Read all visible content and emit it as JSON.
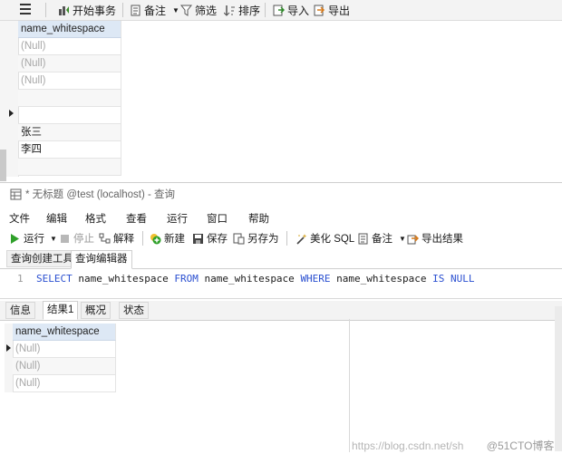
{
  "top_toolbar": {
    "begin_transaction": "开始事务",
    "notes": "备注",
    "filter": "筛选",
    "sort": "排序",
    "import": "导入",
    "export": "导出"
  },
  "top_grid": {
    "column": "name_whitespace",
    "rows": [
      "(Null)",
      "(Null)",
      "(Null)",
      "",
      "",
      "张三",
      "李四",
      ""
    ]
  },
  "query_window": {
    "title": "* 无标题 @test (localhost) - 查询",
    "menu": [
      "文件",
      "编辑",
      "格式",
      "查看",
      "运行",
      "窗口",
      "帮助"
    ],
    "toolbar": {
      "run": "运行",
      "stop": "停止",
      "explain": "解释",
      "new": "新建",
      "save": "保存",
      "save_as": "另存为",
      "beautify_sql": "美化 SQL",
      "notes": "备注",
      "export_result": "导出结果"
    },
    "tabs": {
      "builder": "查询创建工具",
      "editor": "查询编辑器"
    },
    "editor": {
      "line_number": "1",
      "sql": {
        "select": "SELECT",
        "col": " name_whitespace ",
        "from": "FROM",
        "table": " name_whitespace ",
        "where": "WHERE",
        "col2": " name_whitespace ",
        "is": "IS",
        "null": "NULL"
      }
    },
    "result_tabs": {
      "info": "信息",
      "result1": "结果1",
      "overview": "概况",
      "status": "状态"
    },
    "result_grid": {
      "column": "name_whitespace",
      "rows": [
        "(Null)",
        "(Null)",
        "(Null)"
      ]
    }
  },
  "watermark": {
    "url": "https://blog.csdn.net/sh",
    "logo": "@51CTO博客"
  }
}
